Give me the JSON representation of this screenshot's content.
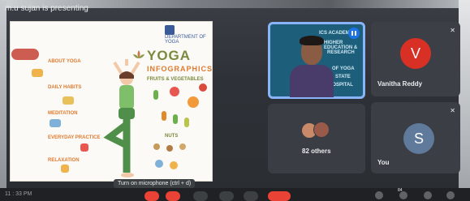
{
  "meeting": {
    "presenting_text": "m.u sujan is presenting",
    "tooltip": "Turn on microphone (ctrl + d)",
    "clock": "11 : 33 PM"
  },
  "slide": {
    "department": "DEPARTMENT OF YOGA",
    "title": "YOGA",
    "subtitle": "INFOGRAPHICS",
    "section_fruits": "FRUITS & VEGETABLES",
    "side_labels": [
      "ABOUT YOGA",
      "DAILY HABITS",
      "MEDITATION",
      "EVERYDAY PRACTICE",
      "RELAXATION"
    ],
    "section_nuts": "NUTS"
  },
  "participants": {
    "active": {
      "overlay_lines": [
        "ICS ACADEMY",
        "HIGHER EDUCATION &",
        "RESEARCH",
        "OF YOGA",
        "STATE",
        "HOSPITAL"
      ],
      "speaking_icon": "audio-bars-icon"
    },
    "vanitha": {
      "initial": "V",
      "name": "Vanitha Reddy",
      "color": "#d93025",
      "status_icon": "mic-off-icon"
    },
    "others": {
      "label": "82 others"
    },
    "you": {
      "initial": "S",
      "name": "You",
      "color": "#5f7a9a",
      "status_icon": "mic-off-icon"
    }
  },
  "toolbar": {
    "buttons": [
      "mic-off-icon",
      "camera-off-icon",
      "captions-icon",
      "present-icon",
      "more-icon",
      "leave-call-icon"
    ],
    "right_icons": [
      "info-icon",
      "people-icon",
      "chat-icon",
      "activities-icon"
    ],
    "participant_count": "84"
  }
}
